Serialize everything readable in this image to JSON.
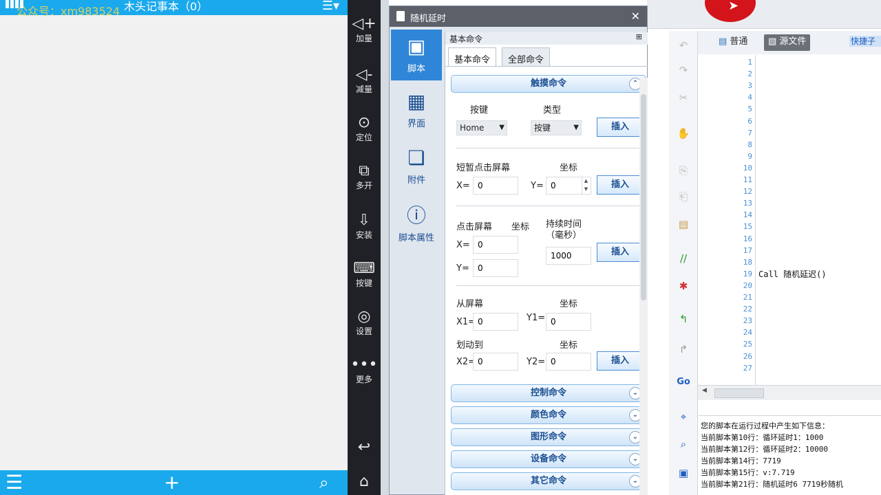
{
  "phone": {
    "watermark": "公众号：xm983524",
    "title": "木头记事本（0）",
    "bottom_icons": [
      "menu-icon",
      "plus-icon",
      "search-icon"
    ]
  },
  "sidebar": {
    "items": [
      {
        "label": "加量",
        "icon": "volume-up-icon"
      },
      {
        "label": "减量",
        "icon": "volume-down-icon"
      },
      {
        "label": "定位",
        "icon": "location-icon"
      },
      {
        "label": "多开",
        "icon": "multi-open-icon"
      },
      {
        "label": "安装",
        "icon": "install-apk-icon"
      },
      {
        "label": "按键",
        "icon": "keyboard-icon"
      },
      {
        "label": "设置",
        "icon": "settings-icon"
      },
      {
        "label": "更多",
        "icon": "more-icon"
      }
    ],
    "bottom_icons": [
      "back-icon",
      "home-icon"
    ]
  },
  "dialog": {
    "title": "随机延时",
    "nav": [
      {
        "label": "脚本",
        "icon": "script-icon"
      },
      {
        "label": "界面",
        "icon": "ui-grid-icon"
      },
      {
        "label": "附件",
        "icon": "attachment-icon"
      },
      {
        "label": "脚本属性",
        "icon": "info-icon"
      }
    ],
    "panel_title": "基本命令",
    "tabs": [
      "基本命令",
      "全部命令"
    ],
    "touch_section": "触摸命令",
    "key": {
      "label_key": "按键",
      "label_type": "类型",
      "key_value": "Home",
      "type_value": "按键",
      "insert": "插入"
    },
    "tap": {
      "label": "短暂点击屏幕",
      "coord_label": "坐标",
      "x_label": "X=",
      "x_value": "0",
      "y_label": "Y=",
      "y_value": "0",
      "insert": "插入"
    },
    "hold": {
      "label": "点击屏幕",
      "coord_label": "坐标",
      "duration_label": "持续时间（毫秒）",
      "x_label": "X=",
      "x_value": "0",
      "y_label": "Y=",
      "y_value": "0",
      "duration_value": "1000",
      "insert": "插入"
    },
    "swipe": {
      "from_label": "从屏幕",
      "from_coord": "坐标",
      "x1_label": "X1=",
      "x1_value": "0",
      "y1_label": "Y1=",
      "y1_value": "0",
      "to_label": "划动到",
      "to_coord": "坐标",
      "x2_label": "X2=",
      "x2_value": "0",
      "y2_label": "Y2=",
      "y2_value": "0",
      "insert": "插入"
    },
    "sections": [
      "控制命令",
      "颜色命令",
      "图形命令",
      "设备命令",
      "其它命令"
    ]
  },
  "editor": {
    "toolbar": {
      "normal": "普通",
      "source": "源文件",
      "shortcut": "快捷子程序"
    },
    "line_numbers": [
      "1",
      "2",
      "3",
      "4",
      "5",
      "6",
      "7",
      "8",
      "9",
      "10",
      "11",
      "12",
      "13",
      "14",
      "15",
      "16",
      "17",
      "18",
      "19",
      "20",
      "21",
      "22",
      "23",
      "24",
      "25",
      "26",
      "27"
    ],
    "code_line_no": "19",
    "code_text": "Call 随机延迟()",
    "output_lines": [
      "您的脚本在运行过程中产生如下信息：",
      "当前脚本第10行：循环延时1：1000",
      "当前脚本第12行：循环延时2：10000",
      "当前脚本第14行：7719",
      "当前脚本第15行：v:7.719",
      "当前脚本第21行：随机延时6 7719秒随机"
    ]
  },
  "colors": {
    "phone_accent": "#1aa9ec",
    "nav_active": "#2f86d8",
    "record_button": "#d3141a"
  }
}
